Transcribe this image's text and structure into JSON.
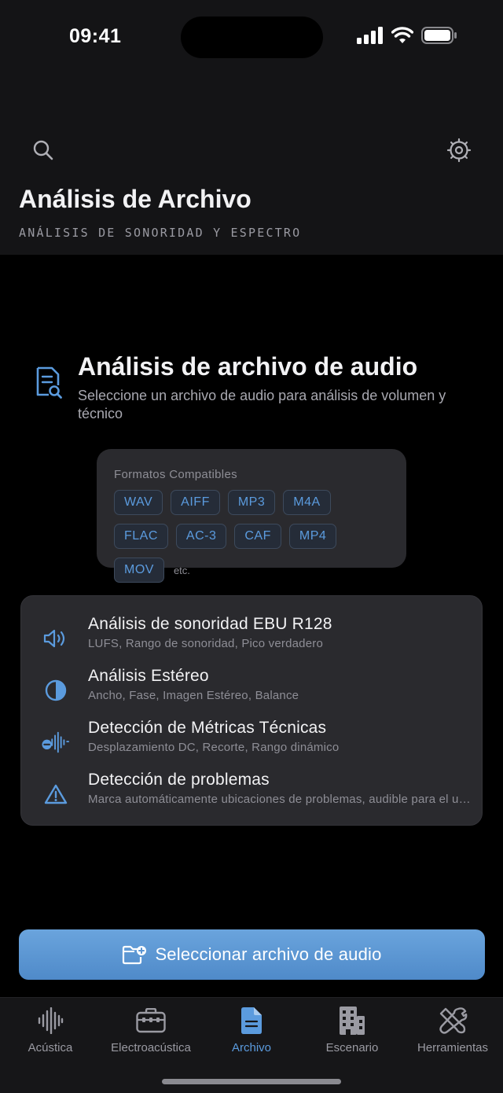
{
  "status": {
    "time": "09:41"
  },
  "header": {
    "title": "Análisis de Archivo",
    "subtitle": "ANÁLISIS DE SONORIDAD Y ESPECTRO"
  },
  "hero": {
    "title": "Análisis de archivo de audio",
    "description": "Seleccione un archivo de audio para análisis de volumen y técnico"
  },
  "formats": {
    "label": "Formatos Compatibles",
    "items": [
      "WAV",
      "AIFF",
      "MP3",
      "M4A",
      "FLAC",
      "AC-3",
      "CAF",
      "MP4",
      "MOV"
    ],
    "etc": "etc."
  },
  "features": [
    {
      "title": "Análisis de sonoridad EBU R128",
      "description": "LUFS, Rango de sonoridad, Pico verdadero",
      "icon": "speaker-wave-icon"
    },
    {
      "title": "Análisis Estéreo",
      "description": "Ancho, Fase, Imagen Estéreo, Balance",
      "icon": "half-circle-icon"
    },
    {
      "title": "Detección de Métricas Técnicas",
      "description": "Desplazamiento DC, Recorte, Rango dinámico",
      "icon": "waveform-minus-icon"
    },
    {
      "title": "Detección de problemas",
      "description": "Marca automáticamente ubicaciones de problemas, audible para el usuario",
      "icon": "warning-triangle-icon"
    }
  ],
  "cta": {
    "label": "Seleccionar archivo de audio"
  },
  "tabs": [
    {
      "label": "Acústica",
      "icon": "waveform-icon",
      "active": false
    },
    {
      "label": "Electroacústica",
      "icon": "equipment-case-icon",
      "active": false
    },
    {
      "label": "Archivo",
      "icon": "document-icon",
      "active": true
    },
    {
      "label": "Escenario",
      "icon": "building-icon",
      "active": false
    },
    {
      "label": "Herramientas",
      "icon": "tools-icon",
      "active": false
    }
  ],
  "colors": {
    "accent": "#5b9bde",
    "background": "#000000",
    "card": "#2a2a2e",
    "header": "#141416"
  }
}
